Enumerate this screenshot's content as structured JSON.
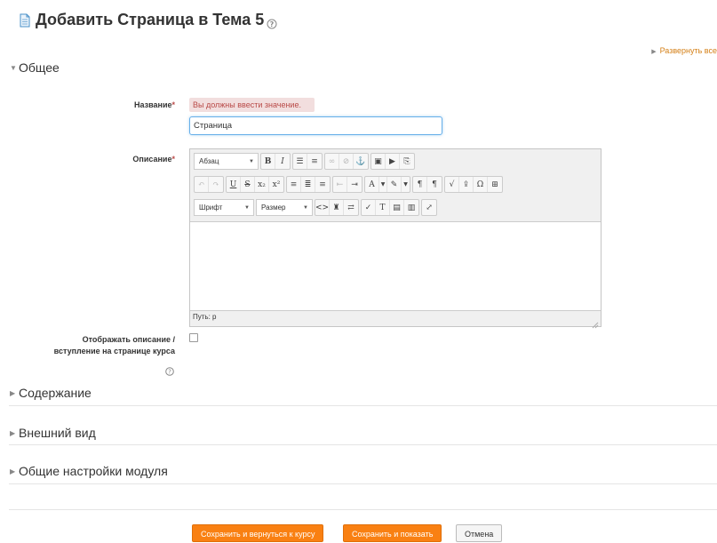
{
  "header": {
    "title": "Добавить Страница в Тема 5"
  },
  "expand_all": "Развернуть все",
  "sections": {
    "general": "Общее",
    "content": "Содержание",
    "appearance": "Внешний вид",
    "module_settings": "Общие настройки модуля"
  },
  "form": {
    "name_label": "Название",
    "required_mark": "*",
    "name_error": "Вы должны ввести значение.",
    "name_value": "Страница",
    "description_label": "Описание",
    "show_description_label_1": "Отображать описание /",
    "show_description_label_2": "вступление на странице курса",
    "show_description_checked": false
  },
  "editor": {
    "format_select": "Абзац",
    "font_select": "Шрифт",
    "size_select": "Размер",
    "path": "Путь: p"
  },
  "buttons": {
    "save_return": "Сохранить и вернуться к курсу",
    "save_show": "Сохранить и показать",
    "cancel": "Отмена"
  },
  "colors": {
    "accent": "#f98012",
    "error_bg": "#f2dede",
    "error_text": "#b94a48",
    "link": "#d47f16"
  },
  "icons": {
    "title_icon": "page-icon",
    "help_icon": "help-icon"
  }
}
